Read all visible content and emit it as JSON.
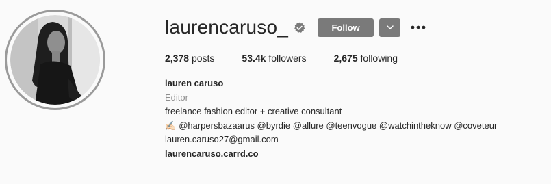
{
  "profile": {
    "username": "laurencaruso_",
    "follow_label": "Follow",
    "stats": {
      "posts_count": "2,378",
      "posts_label": "posts",
      "followers_count": "53.4k",
      "followers_label": "followers",
      "following_count": "2,675",
      "following_label": "following"
    },
    "bio": {
      "full_name": "lauren caruso",
      "category": "Editor",
      "line1": "freelance fashion editor + creative consultant",
      "pen_emoji": "✍🏻",
      "line2": "@harpersbazaarus @byrdie @allure @teenvogue @watchintheknow @coveteur",
      "email": "lauren.caruso27@gmail.com",
      "website": "laurencaruso.carrd.co"
    }
  },
  "colors": {
    "background": "#fafafa",
    "text": "#262626",
    "muted": "#8e8e8e",
    "button": "#7a7a7a",
    "avatar_ring": "#9a9a9a"
  },
  "icons": {
    "verified": "verified-badge-icon",
    "dropdown": "chevron-down-icon",
    "more": "more-options-icon"
  }
}
